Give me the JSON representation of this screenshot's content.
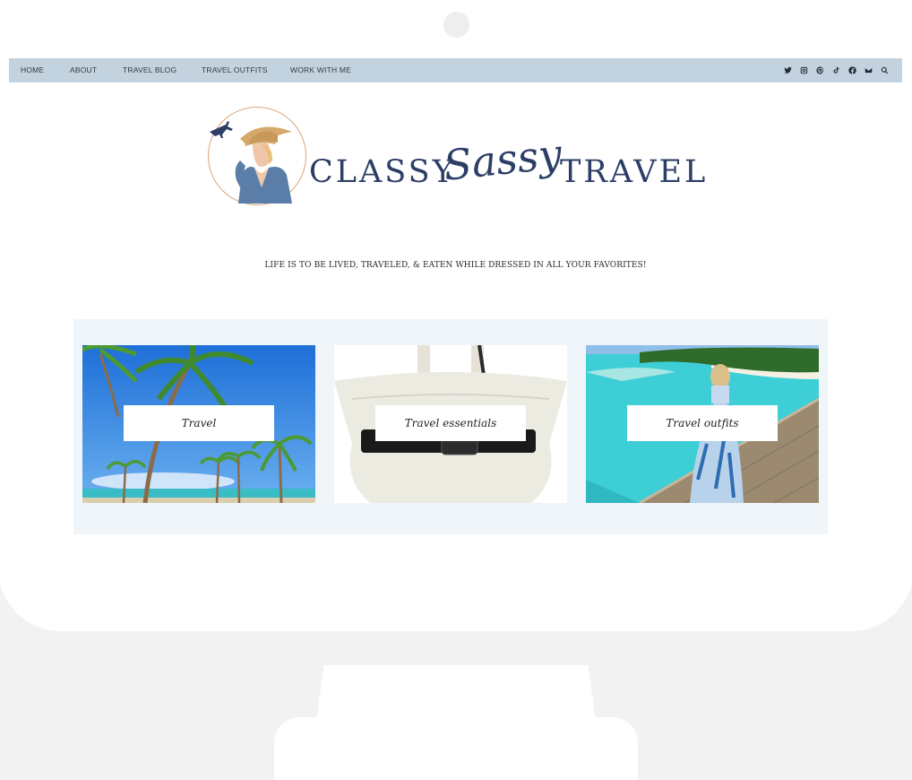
{
  "nav": {
    "items": [
      {
        "label": "HOME"
      },
      {
        "label": "ABOUT"
      },
      {
        "label": "TRAVEL BLOG"
      },
      {
        "label": "TRAVEL OUTFITS"
      },
      {
        "label": "WORK WITH ME"
      }
    ],
    "social_icons": [
      "twitter-icon",
      "instagram-icon",
      "pinterest-icon",
      "tiktok-icon",
      "facebook-icon",
      "email-icon",
      "search-icon"
    ]
  },
  "logo": {
    "word1": "CLASSY",
    "word2": "Sassy",
    "word3": "TRAVEL"
  },
  "tagline": "LIFE IS TO BE LIVED, TRAVELED, & EATEN WHILE DRESSED IN ALL YOUR FAVORITES!",
  "cards": [
    {
      "label": "Travel"
    },
    {
      "label": "Travel essentials"
    },
    {
      "label": "Travel outfits"
    }
  ],
  "colors": {
    "nav_bg": "#c2d2de",
    "brand_navy": "#2c3e66",
    "accent_tan": "#d8a57a",
    "section_bg": "#f0f5fa"
  }
}
